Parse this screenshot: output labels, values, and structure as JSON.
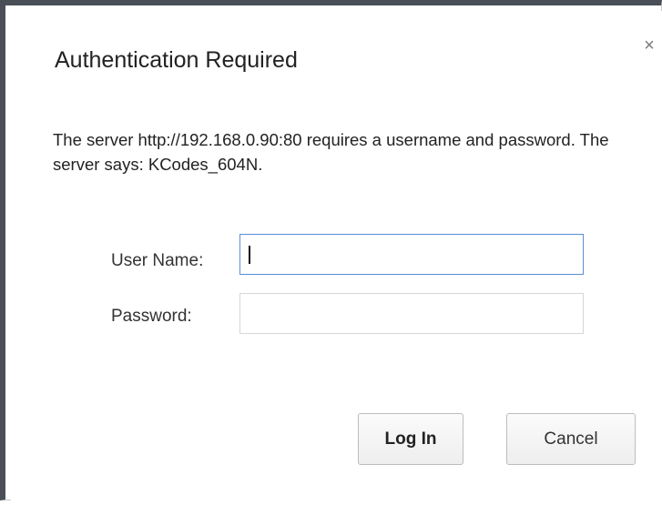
{
  "dialog": {
    "title": "Authentication Required",
    "close_symbol": "×",
    "message": "The server http://192.168.0.90:80 requires a username and password. The server says: KCodes_604N.",
    "username_label": "User Name:",
    "username_value": "",
    "password_label": "Password:",
    "password_value": "",
    "login_label": "Log In",
    "cancel_label": "Cancel"
  },
  "colors": {
    "focus_border": "#5a8fd6",
    "frame": "#4a4f57"
  }
}
